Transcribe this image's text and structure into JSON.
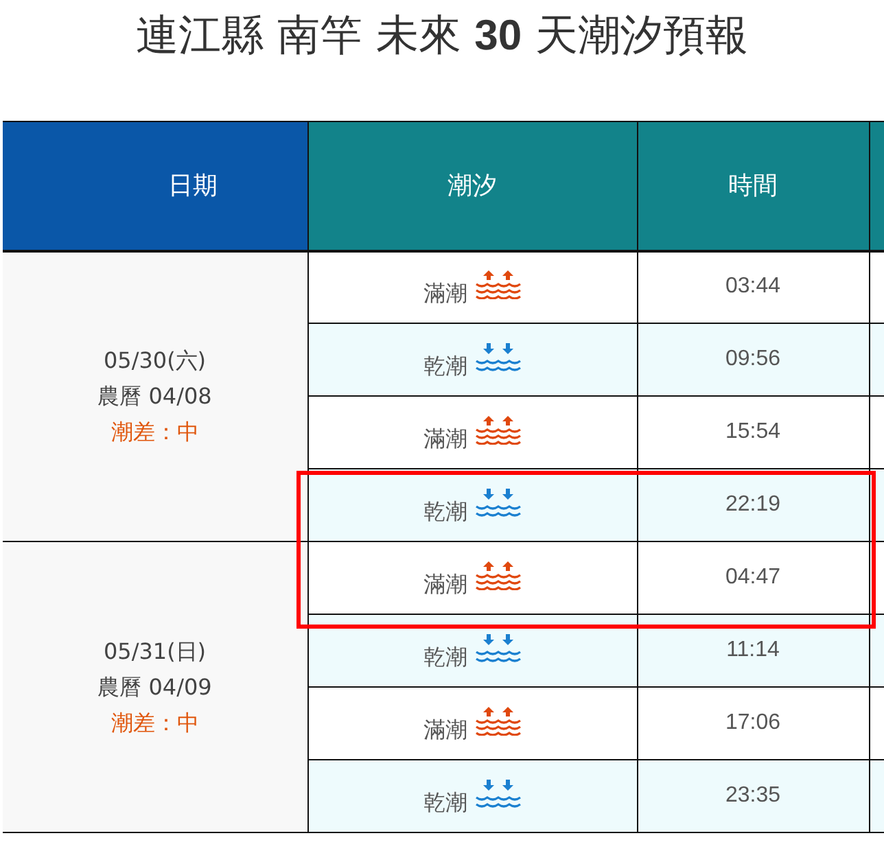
{
  "title": "連江縣 南竿 未來 **30** 天潮汐預報",
  "table": {
    "columns": [
      {
        "label": "日期",
        "kind": "date"
      },
      {
        "label": "潮汐",
        "kind": "tide"
      },
      {
        "label": "時間",
        "kind": "time"
      },
      {
        "kind": "cut"
      }
    ],
    "days": [
      {
        "date": "05/30(六)",
        "lunar": "農曆 04/08",
        "range": "潮差：中",
        "tides": [
          {
            "kind": "high",
            "label": "滿潮",
            "time": "03:44"
          },
          {
            "kind": "low",
            "label": "乾潮",
            "time": "09:56"
          },
          {
            "kind": "high",
            "label": "滿潮",
            "time": "15:54"
          },
          {
            "kind": "low",
            "label": "乾潮",
            "time": "22:19"
          }
        ]
      },
      {
        "date": "05/31(日)",
        "lunar": "農曆 04/09",
        "range": "潮差：中",
        "tides": [
          {
            "kind": "high",
            "label": "滿潮",
            "time": "04:47"
          },
          {
            "kind": "low",
            "label": "乾潮",
            "time": "11:14"
          },
          {
            "kind": "high",
            "label": "滿潮",
            "time": "17:06"
          },
          {
            "kind": "low",
            "label": "乾潮",
            "time": "23:35"
          }
        ]
      }
    ]
  }
}
